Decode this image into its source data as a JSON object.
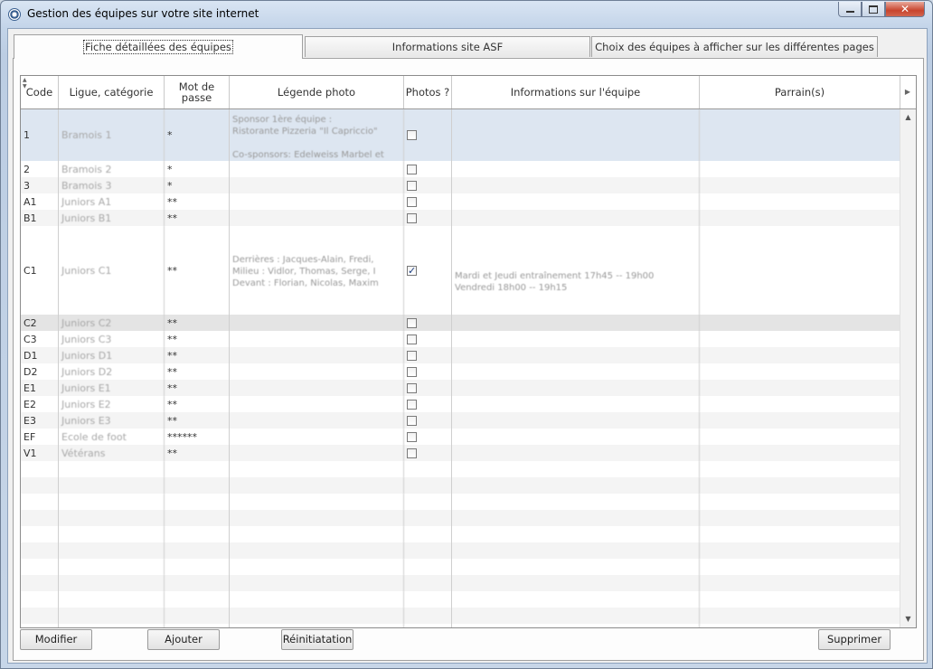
{
  "window": {
    "title": "Gestion des équipes sur votre site internet",
    "min_glyph": "–",
    "max_glyph": "□",
    "close_glyph": "✕"
  },
  "tabs": [
    {
      "label": "Fiche détaillées des équipes",
      "active": true
    },
    {
      "label": "Informations site ASF",
      "active": false
    },
    {
      "label": "Choix des équipes à afficher sur les différentes pages",
      "active": false
    }
  ],
  "grid": {
    "columns": [
      "Code",
      "Ligue, catégorie",
      "Mot de passe",
      "Légende photo",
      "Photos ?",
      "Informations sur l'équipe",
      "Parrain(s)"
    ],
    "rows": [
      {
        "code": "1",
        "ligue": "Bramois 1",
        "mdp": "*",
        "legende": "Sponsor 1ère équipe :\nRistorante Pizzeria \"Il Capriccio\"\n\nCo-sponsors: Edelweiss Marbel et",
        "photos": false,
        "info": "",
        "parrain": ""
      },
      {
        "code": "2",
        "ligue": "Bramois 2",
        "mdp": "*",
        "legende": "",
        "photos": false,
        "info": "",
        "parrain": ""
      },
      {
        "code": "3",
        "ligue": "Bramois 3",
        "mdp": "*",
        "legende": "",
        "photos": false,
        "info": "",
        "parrain": ""
      },
      {
        "code": "A1",
        "ligue": "Juniors A1",
        "mdp": "**",
        "legende": "",
        "photos": false,
        "info": "",
        "parrain": ""
      },
      {
        "code": "B1",
        "ligue": "Juniors B1",
        "mdp": "**",
        "legende": "",
        "photos": false,
        "info": "",
        "parrain": ""
      },
      {
        "code": "C1",
        "ligue": "Juniors C1",
        "mdp": "**",
        "legende": "\n\nDerrières : Jacques-Alain, Fredi,\nMilieu : Vidlor, Thomas, Serge, I\nDevant : Florian, Nicolas, Maxim",
        "photos": true,
        "info": "\n\nMardi et Jeudi entraînement 17h45 -- 19h00\nVendredi 18h00 -- 19h15",
        "parrain": ""
      },
      {
        "code": "C2",
        "ligue": "Juniors C2",
        "mdp": "**",
        "legende": "",
        "photos": false,
        "info": "",
        "parrain": ""
      },
      {
        "code": "C3",
        "ligue": "Juniors C3",
        "mdp": "**",
        "legende": "",
        "photos": false,
        "info": "",
        "parrain": ""
      },
      {
        "code": "D1",
        "ligue": "Juniors D1",
        "mdp": "**",
        "legende": "",
        "photos": false,
        "info": "",
        "parrain": ""
      },
      {
        "code": "D2",
        "ligue": "Juniors D2",
        "mdp": "**",
        "legende": "",
        "photos": false,
        "info": "",
        "parrain": ""
      },
      {
        "code": "E1",
        "ligue": "Juniors E1",
        "mdp": "**",
        "legende": "",
        "photos": false,
        "info": "",
        "parrain": ""
      },
      {
        "code": "E2",
        "ligue": "Juniors E2",
        "mdp": "**",
        "legende": "",
        "photos": false,
        "info": "",
        "parrain": ""
      },
      {
        "code": "E3",
        "ligue": "Juniors E3",
        "mdp": "**",
        "legende": "",
        "photos": false,
        "info": "",
        "parrain": ""
      },
      {
        "code": "EF",
        "ligue": "Ecole de foot",
        "mdp": "******",
        "legende": "",
        "photos": false,
        "info": "",
        "parrain": ""
      },
      {
        "code": "V1",
        "ligue": "Vétérans",
        "mdp": "**",
        "legende": "",
        "photos": false,
        "info": "",
        "parrain": ""
      }
    ]
  },
  "buttons": {
    "modifier": "Modifier",
    "ajouter": "Ajouter",
    "reinit": "Réinitiatation",
    "supprimer": "Supprimer"
  },
  "colors": {
    "selected_row": "#dde6f1",
    "highlight_row": "#e4e4e4"
  }
}
